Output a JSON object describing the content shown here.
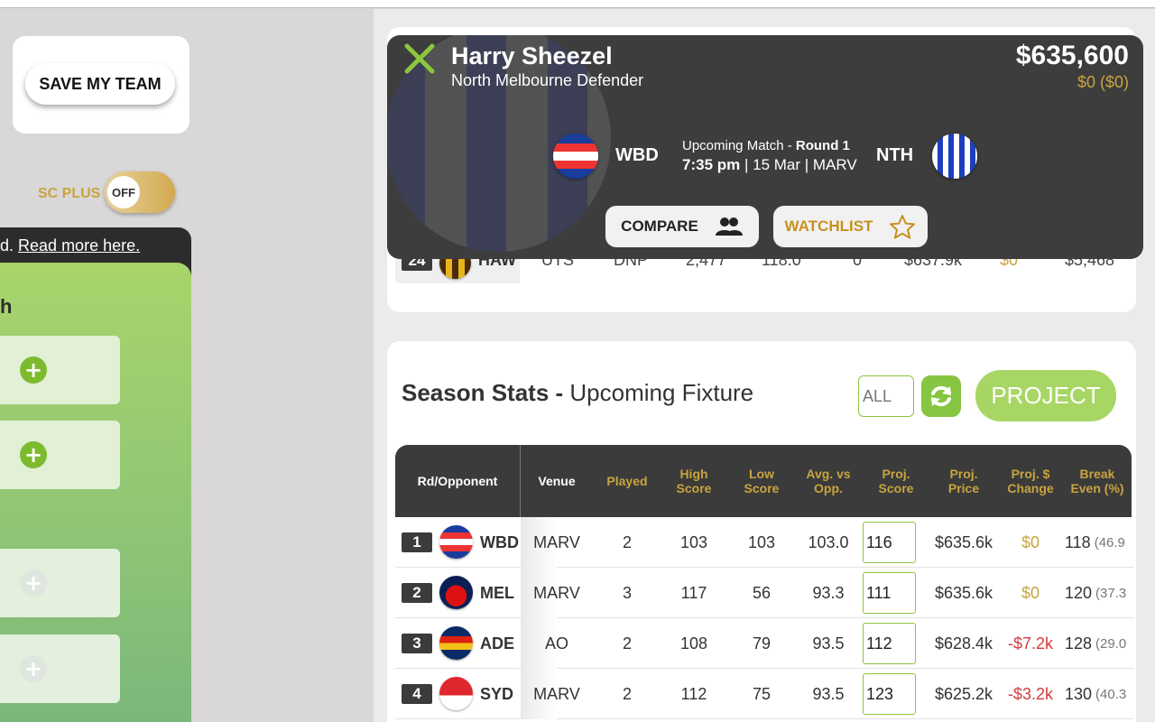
{
  "left": {
    "save_button": "SAVE MY TEAM",
    "sc_plus_label": "SC PLUS",
    "toggle_state": "OFF",
    "notice_text": "d.",
    "notice_link": "Read more here.",
    "panel_heading": "h"
  },
  "popup": {
    "player_name": "Harry Sheezel",
    "player_sub": "North Melbourne Defender",
    "price": "$635,600",
    "price_change": "$0  ($0)",
    "home_team": "WBD",
    "away_team": "NTH",
    "upcoming_label": "Upcoming Match - ",
    "round": "Round 1",
    "match_time": "7:35 pm",
    "match_rest": " | 15 Mar | MARV",
    "compare_label": "COMPARE",
    "watchlist_label": "WATCHLIST"
  },
  "bg_row": {
    "round": "24",
    "team": "HAW",
    "venue": "UTS",
    "played": "DNP",
    "high": "2,477",
    "low": "118.0",
    "avg": "0",
    "price": "$637.9k",
    "change": "$0",
    "be": "$5,468"
  },
  "season": {
    "title_bold": "Season Stats - ",
    "title_rest": "Upcoming Fixture",
    "filter_placeholder": "ALL",
    "project_label": "PROJECT",
    "headers": {
      "rd": "Rd/Opponent",
      "venue": "Venue",
      "played": "Played",
      "high": "High Score",
      "low": "Low Score",
      "avg": "Avg. vs Opp.",
      "proj_score": "Proj. Score",
      "proj_price": "Proj. Price",
      "proj_change": "Proj. $ Change",
      "be": "Break Even (%)"
    },
    "rows": [
      {
        "rd": "1",
        "team": "WBD",
        "venue": "MARV",
        "played": "2",
        "high": "103",
        "low": "103",
        "avg": "103.0",
        "proj": "116",
        "price": "$635.6k",
        "change": "$0",
        "be": "118",
        "be_pct": "(46.9"
      },
      {
        "rd": "2",
        "team": "MEL",
        "venue": "MARV",
        "played": "3",
        "high": "117",
        "low": "56",
        "avg": "93.3",
        "proj": "111",
        "price": "$635.6k",
        "change": "$0",
        "be": "120",
        "be_pct": "(37.3"
      },
      {
        "rd": "3",
        "team": "ADE",
        "venue": "AO",
        "played": "2",
        "high": "108",
        "low": "79",
        "avg": "93.5",
        "proj": "112",
        "price": "$628.4k",
        "change": "-$7.2k",
        "be": "128",
        "be_pct": "(29.0"
      },
      {
        "rd": "4",
        "team": "SYD",
        "venue": "MARV",
        "played": "2",
        "high": "112",
        "low": "75",
        "avg": "93.5",
        "proj": "123",
        "price": "$625.2k",
        "change": "-$3.2k",
        "be": "130",
        "be_pct": "(40.3"
      }
    ]
  },
  "colors": {
    "gold": "#c8a43f",
    "green": "#86c540",
    "dark": "#3b3b3b",
    "red": "#d13b3b"
  }
}
